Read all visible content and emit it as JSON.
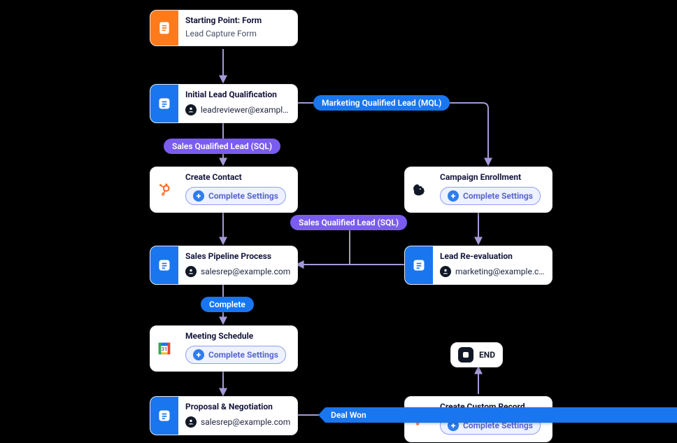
{
  "common": {
    "complete_settings_label": "Complete Settings"
  },
  "nodes": {
    "start": {
      "title": "Starting Point: Form",
      "sub": "Lead Capture Form"
    },
    "qualify": {
      "title": "Initial Lead Qualification",
      "assignee": "leadreviewer@exampl…"
    },
    "contact": {
      "title": "Create Contact"
    },
    "campaign": {
      "title": "Campaign Enrollment"
    },
    "pipeline": {
      "title": "Sales Pipeline Process",
      "assignee": "salesrep@example.com"
    },
    "reeval": {
      "title": "Lead Re-evaluation",
      "assignee": "marketing@example.c…"
    },
    "meeting": {
      "title": "Meeting Schedule"
    },
    "proposal": {
      "title": "Proposal & Negotiation",
      "assignee": "salesrep@example.com"
    },
    "customrec": {
      "title": "Create Custom Record"
    },
    "end": {
      "label": "END"
    }
  },
  "edges": {
    "sql1": {
      "label": "Sales Qualified Lead (SQL)"
    },
    "mql": {
      "label": "Marketing Qualified Lead (MQL)"
    },
    "sql2": {
      "label": "Sales Qualified Lead (SQL)"
    },
    "complete": {
      "label": "Complete"
    },
    "dealwon": {
      "label": "Deal Won"
    }
  },
  "colors": {
    "bg": "#000000",
    "node_bg": "#ffffff",
    "orange": "#ff7a1a",
    "blue": "#1976ef",
    "purple": "#7a5cf0",
    "connector": "#a39bd8"
  }
}
